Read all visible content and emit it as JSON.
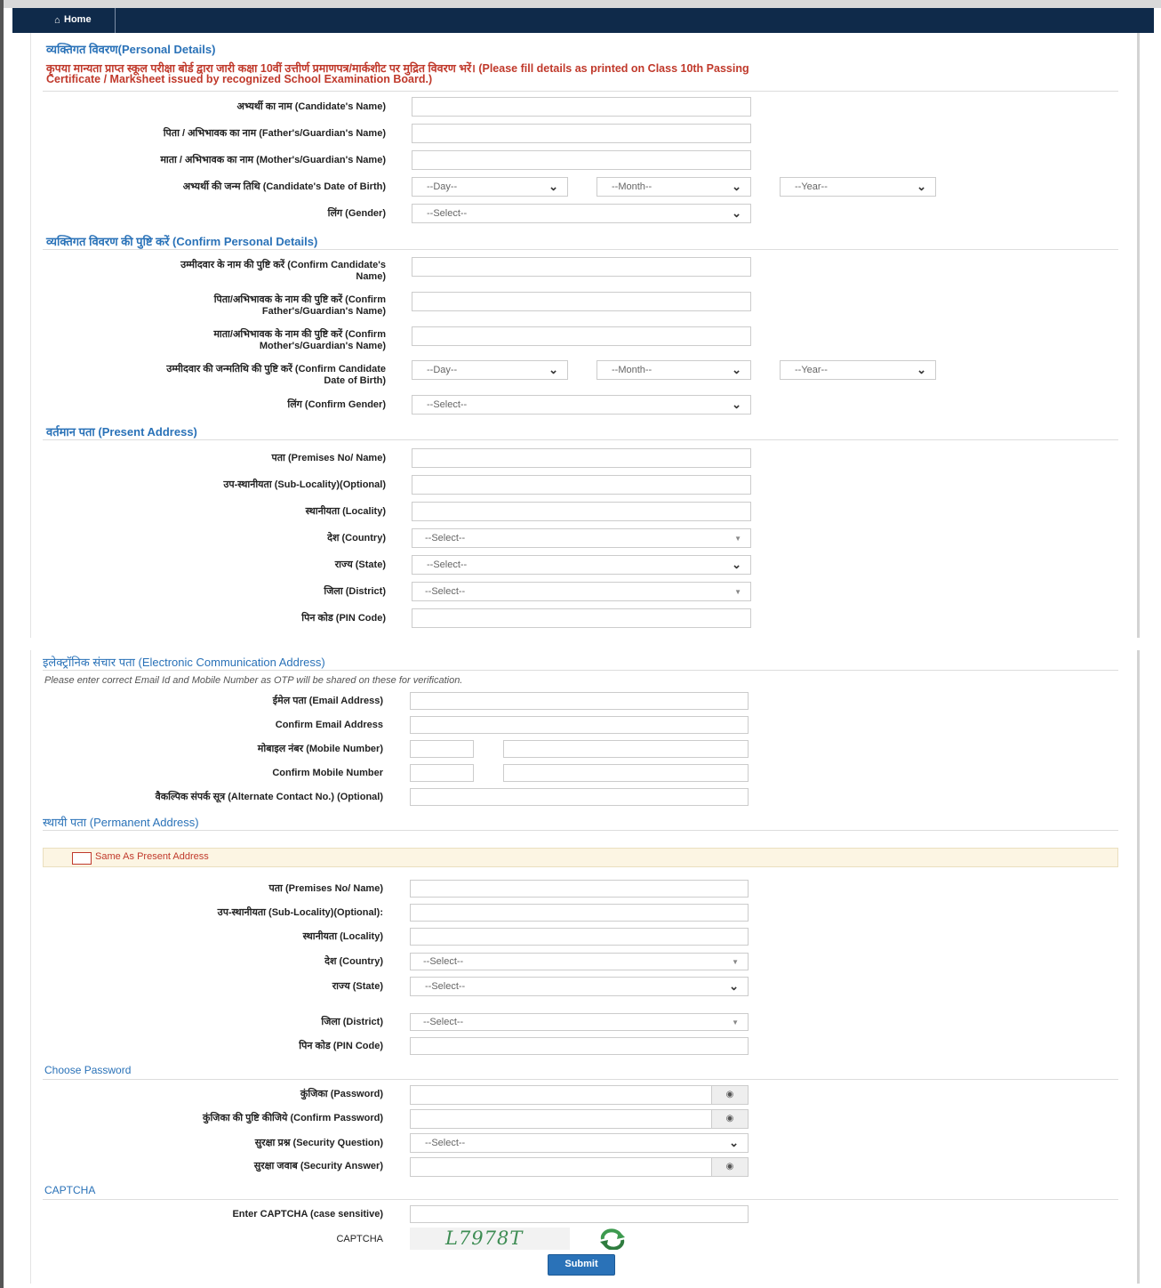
{
  "nav": {
    "home_label": "Home"
  },
  "personal": {
    "title": "व्यक्तिगत विवरण(Personal Details)",
    "notice_line1": "कृपया मान्यता प्राप्त स्कूल परीक्षा बोर्ड द्वारा जारी कक्षा 10वीं उत्तीर्ण प्रमाणपत्र/मार्कशीट पर मुद्रित विवरण भरें। (Please fill details as printed on Class 10th Passing",
    "notice_line2": "Certificate / Marksheet issued by recognized School Examination Board.)",
    "candidate_name_label": "अभ्यर्थी का नाम (Candidate's Name)",
    "father_name_label": "पिता / अभिभावक का नाम (Father's/Guardian's Name)",
    "mother_name_label": "माता / अभिभावक का नाम (Mother's/Guardian's Name)",
    "dob_label": "अभ्यर्थी की जन्म तिथि (Candidate's Date of Birth)",
    "gender_label": "लिंग (Gender)",
    "day_select": "--Day--",
    "month_select": "--Month--",
    "year_select": "--Year--",
    "gender_select": "--Select--"
  },
  "confirm": {
    "title": "व्यक्तिगत विवरण की पुष्टि करें (Confirm Personal Details)",
    "name_label_1": "उम्मीदवार के नाम की पुष्टि करें (Confirm Candidate's",
    "name_label_2": "Name)",
    "father_label_1": "पिता/अभिभावक के नाम की पुष्टि करें (Confirm",
    "father_label_2": "Father's/Guardian's Name)",
    "mother_label_1": "माता/अभिभावक के नाम की पुष्टि करें (Confirm",
    "mother_label_2": "Mother's/Guardian's Name)",
    "dob_label_1": "उम्मीदवार की जन्मतिथि की पुष्टि करें (Confirm Candidate",
    "dob_label_2": "Date of Birth)",
    "gender_label": "लिंग (Confirm Gender)",
    "day_select": "--Day--",
    "month_select": "--Month--",
    "year_select": "--Year--",
    "gender_select": "--Select--"
  },
  "present": {
    "title": "वर्तमान पता (Present Address)",
    "premises_label": "पता (Premises No/ Name)",
    "sublocality_label": "उप-स्थानीयता (Sub-Locality)(Optional)",
    "locality_label": "स्थानीयता (Locality)",
    "country_label": "देश (Country)",
    "state_label": "राज्य (State)",
    "district_label": "जिला (District)",
    "pin_label": "पिन कोड (PIN Code)",
    "country_select": "--Select--",
    "state_select": "--Select--",
    "district_select": "--Select--"
  },
  "electronic": {
    "title": "इलेक्ट्रॉनिक संचार पता (Electronic Communication Address)",
    "hint": "Please enter correct Email Id and Mobile Number as OTP will be shared on these for verification.",
    "email_label": "ईमेल पता (Email Address)",
    "confirm_email_label": "Confirm Email Address",
    "mobile_label": "मोबाइल नंबर (Mobile Number)",
    "confirm_mobile_label": "Confirm Mobile Number",
    "alt_contact_label": "वैकल्पिक संपर्क सूत्र (Alternate Contact No.) (Optional)"
  },
  "permanent": {
    "title": "स्थायी पता (Permanent Address)",
    "same_as_present": "Same As Present Address",
    "premises_label": "पता (Premises No/ Name)",
    "sublocality_label": "उप-स्थानीयता (Sub-Locality)(Optional):",
    "locality_label": "स्थानीयता (Locality)",
    "country_label": "देश (Country)",
    "state_label": "राज्य (State)",
    "district_label": "जिला (District)",
    "pin_label": "पिन कोड (PIN Code)",
    "country_select": "--Select--",
    "state_select": "--Select--",
    "district_select": "--Select--"
  },
  "password": {
    "title": "Choose Password",
    "password_label": "कुंजिका (Password)",
    "confirm_password_label": "कुंजिका की पुष्टि कीजिये (Confirm Password)",
    "security_question_label": "सुरक्षा प्रश्न (Security Question)",
    "security_answer_label": "सुरक्षा जवाब (Security Answer)",
    "security_question_select": "--Select--"
  },
  "captcha": {
    "title": "CAPTCHA",
    "enter_label": "Enter CAPTCHA (case sensitive)",
    "captcha_label": "CAPTCHA",
    "captcha_text": "L7978T"
  },
  "submit_label": "Submit"
}
